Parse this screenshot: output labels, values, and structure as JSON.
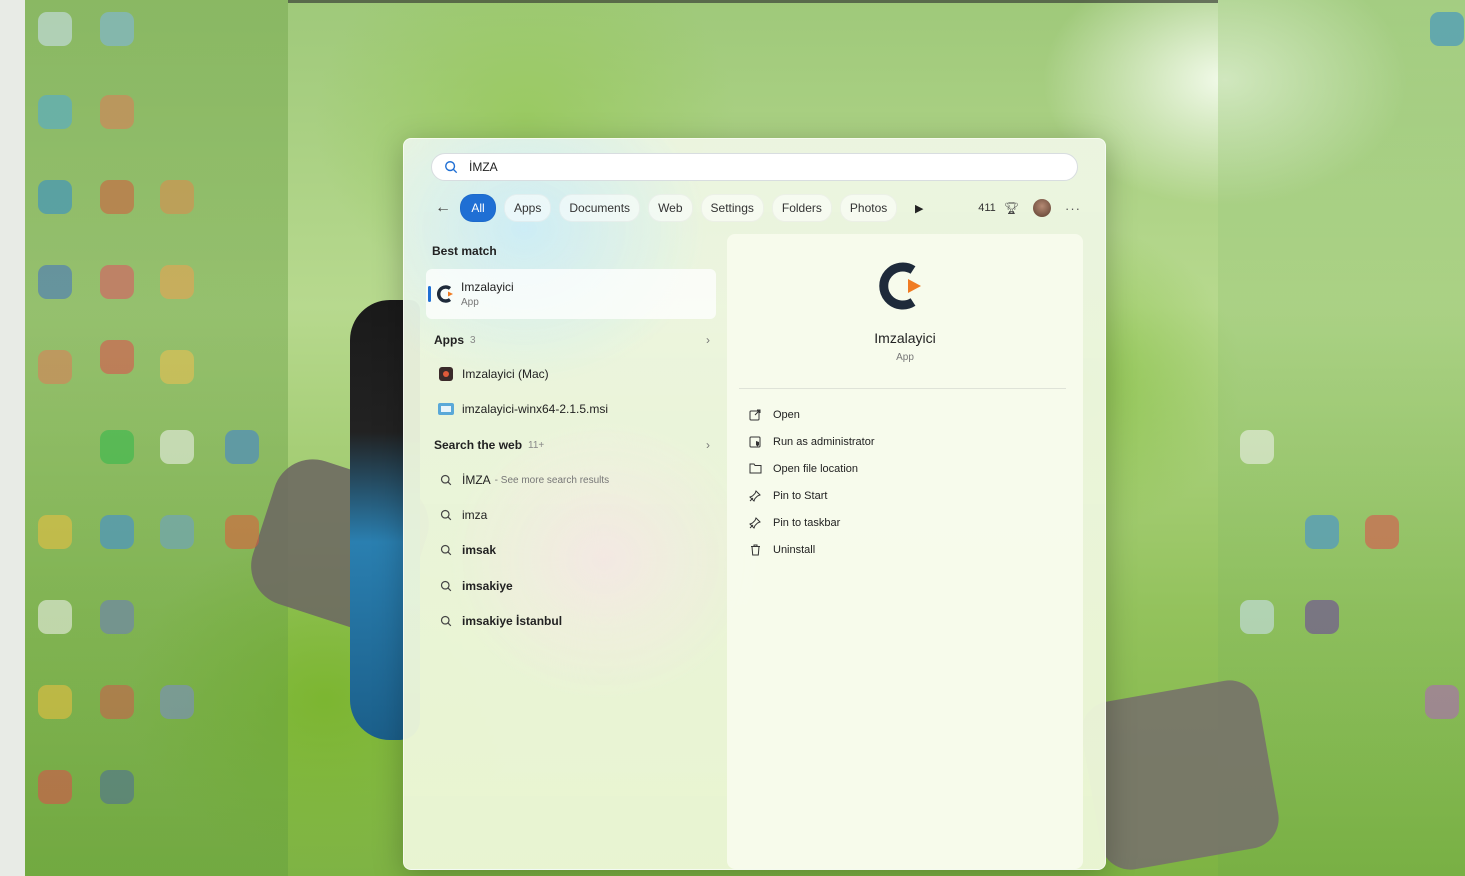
{
  "search": {
    "value": "İMZA"
  },
  "filters": {
    "back_icon": "back-arrow-icon",
    "tabs": [
      "All",
      "Apps",
      "Documents",
      "Web",
      "Settings",
      "Folders",
      "Photos"
    ],
    "more_tabs_icon": "play-icon",
    "count": "411",
    "trophy_icon": "trophy-icon",
    "more_icon": "ellipsis-icon"
  },
  "best_match": {
    "title": "Best match",
    "item": {
      "name": "Imzalayici",
      "sub": "App"
    }
  },
  "apps": {
    "title": "Apps",
    "count": "3",
    "items": [
      {
        "name": "Imzalayici (Mac)"
      },
      {
        "name": "imzalayici-winx64-2.1.5.msi"
      }
    ]
  },
  "web": {
    "title": "Search the web",
    "count": "11+",
    "items": [
      {
        "name": "İMZA",
        "hint": "- See more search results"
      },
      {
        "name": "imza"
      },
      {
        "name": "imsak"
      },
      {
        "name": "imsakiye"
      },
      {
        "name": "imsakiye İstanbul"
      }
    ]
  },
  "preview": {
    "name": "Imzalayici",
    "sub": "App",
    "actions": [
      {
        "label": "Open",
        "icon": "open-external-icon"
      },
      {
        "label": "Run as administrator",
        "icon": "shield-admin-icon"
      },
      {
        "label": "Open file location",
        "icon": "folder-icon"
      },
      {
        "label": "Pin to Start",
        "icon": "pin-icon"
      },
      {
        "label": "Pin to taskbar",
        "icon": "pin-icon"
      },
      {
        "label": "Uninstall",
        "icon": "trash-icon"
      }
    ]
  },
  "colors": {
    "accent": "#1f6fd4",
    "logo_dark": "#1e2a3a",
    "logo_orange": "#f07b22"
  }
}
